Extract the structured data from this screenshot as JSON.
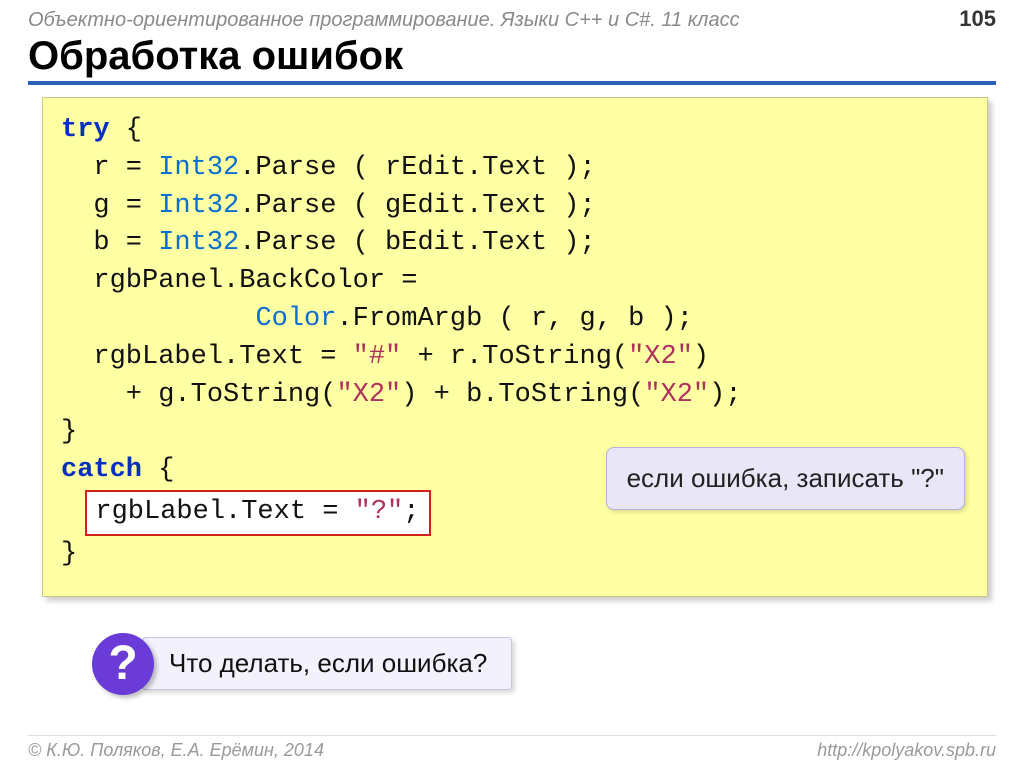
{
  "header": {
    "course": "Объектно-ориентированное программирование. Языки C++ и C#. 11 класс",
    "page": "105"
  },
  "title": "Обработка ошибок",
  "code": {
    "l1a": "try",
    "l1b": " {",
    "l2a": "  r = ",
    "l2cls": "Int32",
    "l2b": ".Parse ( rEdit.Text );",
    "l3a": "  g = ",
    "l3cls": "Int32",
    "l3b": ".Parse ( gEdit.Text );",
    "l4a": "  b = ",
    "l4cls": "Int32",
    "l4b": ".Parse ( bEdit.Text );",
    "l5": "  rgbPanel.BackColor =",
    "l6a": "            ",
    "l6cls": "Color",
    "l6b": ".FromArgb ( r, g, b );",
    "l7a": "  rgbLabel.Text = ",
    "l7s1": "\"#\"",
    "l7b": " + r.ToString(",
    "l7s2": "\"X2\"",
    "l7c": ")",
    "l8a": "    + g.ToString(",
    "l8s1": "\"X2\"",
    "l8b": ") + b.ToString(",
    "l8s2": "\"X2\"",
    "l8c": ");",
    "l9": "}",
    "l10a": "catch",
    "l10b": " {",
    "l11a": "rgbLabel.Text = ",
    "l11s": "\"?\"",
    "l11b": ";",
    "l12": "}"
  },
  "callout": "если ошибка, записать \"?\"",
  "question": {
    "badge": "?",
    "text": "Что делать, если ошибка?"
  },
  "footer": {
    "left": "© К.Ю. Поляков, Е.А. Ерёмин, 2014",
    "right": "http://kpolyakov.spb.ru"
  }
}
